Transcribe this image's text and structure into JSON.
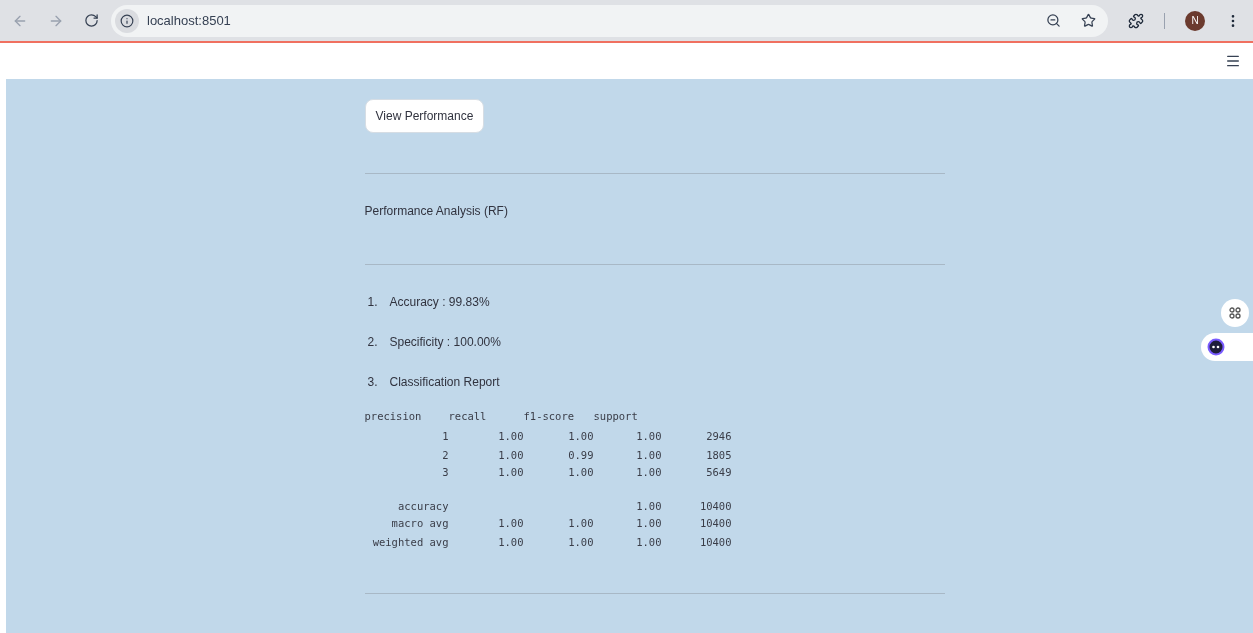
{
  "browser": {
    "url": "localhost:8501",
    "profile_initial": "N"
  },
  "button": {
    "label": "View Performance"
  },
  "title": "Performance Analysis (RF)",
  "metrics": [
    {
      "number": "1.",
      "text": "Accuracy : 99.83%"
    },
    {
      "number": "2.",
      "text": "Specificity : 100.00%"
    },
    {
      "number": "3.",
      "text": "Classification Report"
    }
  ],
  "report": {
    "columns": [
      "precision",
      "recall",
      "f1-score",
      "support"
    ],
    "rows": [
      {
        "label": "1",
        "precision": "1.00",
        "recall": "1.00",
        "f1_score": "1.00",
        "support": "2946"
      },
      {
        "label": "2",
        "precision": "1.00",
        "recall": "0.99",
        "f1_score": "1.00",
        "support": "1805"
      },
      {
        "label": "3",
        "precision": "1.00",
        "recall": "1.00",
        "f1_score": "1.00",
        "support": "5649"
      },
      {
        "label": "accuracy",
        "f1_score": "1.00",
        "support": "10400",
        "gap_before": true
      },
      {
        "label": "macro avg",
        "precision": "1.00",
        "recall": "1.00",
        "f1_score": "1.00",
        "support": "10400"
      },
      {
        "label": "weighted avg",
        "precision": "1.00",
        "recall": "1.00",
        "f1_score": "1.00",
        "support": "10400"
      }
    ]
  }
}
